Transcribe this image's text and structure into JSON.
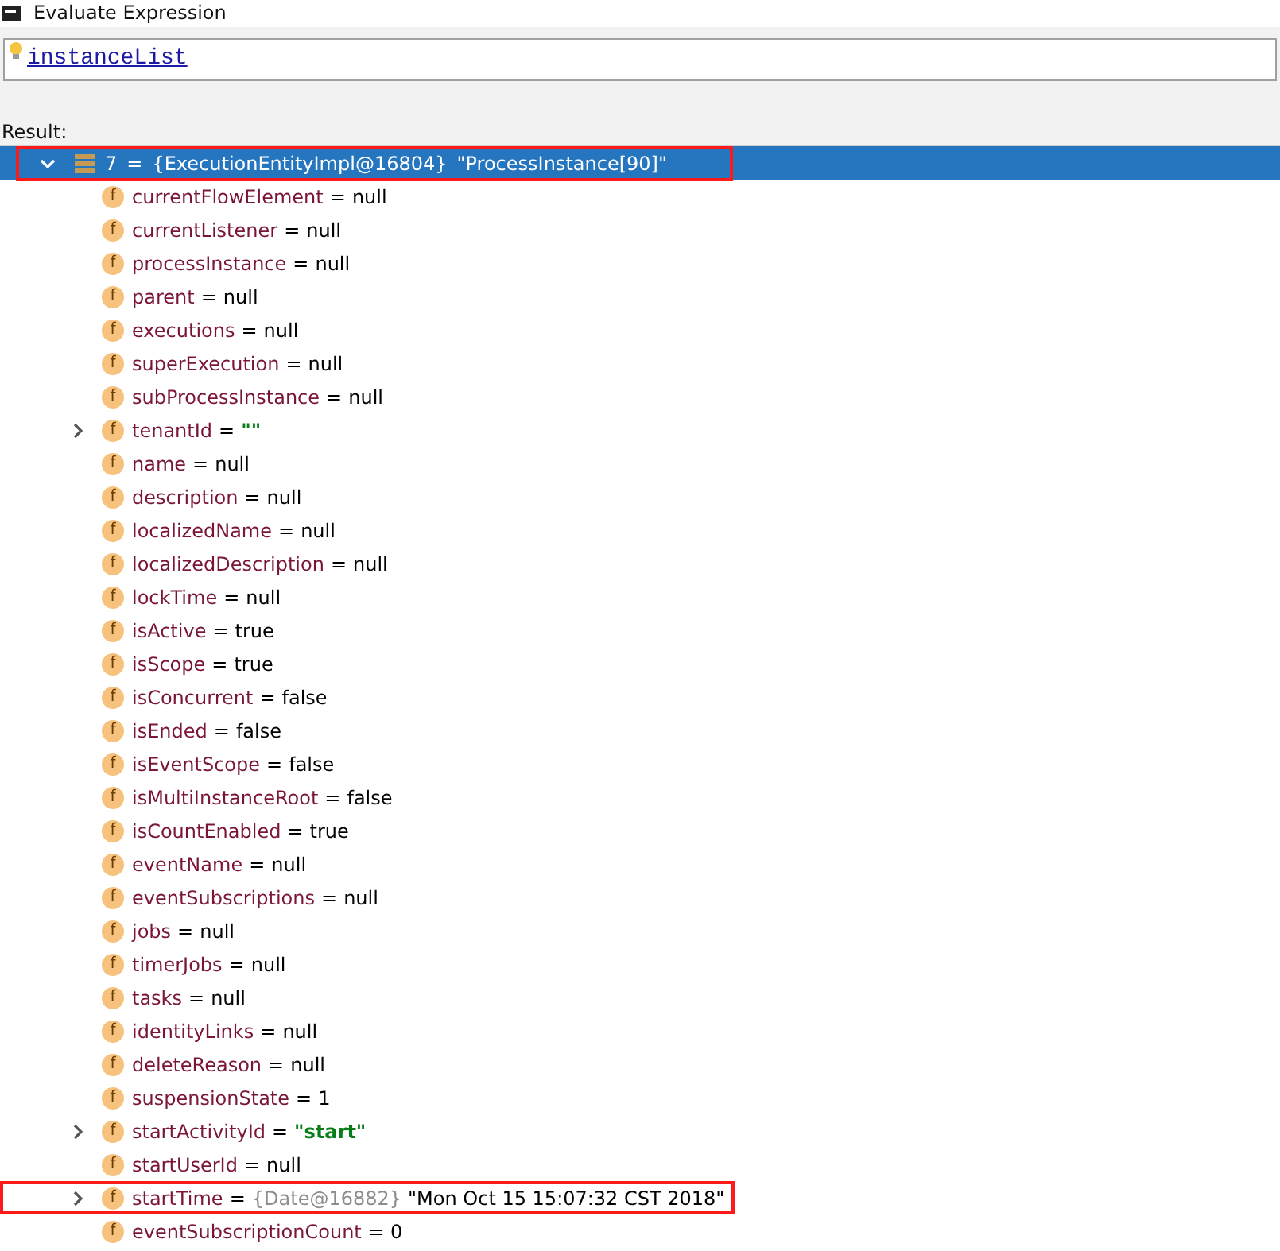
{
  "window": {
    "title": "Evaluate Expression"
  },
  "expression": {
    "value": "instanceList"
  },
  "result_label": "Result:",
  "root": {
    "index": "7",
    "separator": "=",
    "type_label": "{ExecutionEntityImpl@16804}",
    "value": "\"ProcessInstance[90]\"",
    "expanded": true,
    "selected": true,
    "highlighted": true
  },
  "fields": [
    {
      "icon": "f",
      "name": "currentFlowElement",
      "separator": "=",
      "value": "null",
      "kind": "plain",
      "expandable": false,
      "highlighted": false
    },
    {
      "icon": "f",
      "name": "currentListener",
      "separator": "=",
      "value": "null",
      "kind": "plain",
      "expandable": false,
      "highlighted": false
    },
    {
      "icon": "f",
      "name": "processInstance",
      "separator": "=",
      "value": "null",
      "kind": "plain",
      "expandable": false,
      "highlighted": false
    },
    {
      "icon": "f",
      "name": "parent",
      "separator": "=",
      "value": "null",
      "kind": "plain",
      "expandable": false,
      "highlighted": false
    },
    {
      "icon": "f",
      "name": "executions",
      "separator": "=",
      "value": "null",
      "kind": "plain",
      "expandable": false,
      "highlighted": false
    },
    {
      "icon": "f",
      "name": "superExecution",
      "separator": "=",
      "value": "null",
      "kind": "plain",
      "expandable": false,
      "highlighted": false
    },
    {
      "icon": "f",
      "name": "subProcessInstance",
      "separator": "=",
      "value": "null",
      "kind": "plain",
      "expandable": false,
      "highlighted": false
    },
    {
      "icon": "f",
      "name": "tenantId",
      "separator": "=",
      "value": "\"\"",
      "kind": "string",
      "expandable": true,
      "highlighted": false
    },
    {
      "icon": "f",
      "name": "name",
      "separator": "=",
      "value": "null",
      "kind": "plain",
      "expandable": false,
      "highlighted": false
    },
    {
      "icon": "f",
      "name": "description",
      "separator": "=",
      "value": "null",
      "kind": "plain",
      "expandable": false,
      "highlighted": false
    },
    {
      "icon": "f",
      "name": "localizedName",
      "separator": "=",
      "value": "null",
      "kind": "plain",
      "expandable": false,
      "highlighted": false
    },
    {
      "icon": "f",
      "name": "localizedDescription",
      "separator": "=",
      "value": "null",
      "kind": "plain",
      "expandable": false,
      "highlighted": false
    },
    {
      "icon": "f",
      "name": "lockTime",
      "separator": "=",
      "value": "null",
      "kind": "plain",
      "expandable": false,
      "highlighted": false
    },
    {
      "icon": "f",
      "name": "isActive",
      "separator": "=",
      "value": "true",
      "kind": "plain",
      "expandable": false,
      "highlighted": false
    },
    {
      "icon": "f",
      "name": "isScope",
      "separator": "=",
      "value": "true",
      "kind": "plain",
      "expandable": false,
      "highlighted": false
    },
    {
      "icon": "f",
      "name": "isConcurrent",
      "separator": "=",
      "value": "false",
      "kind": "plain",
      "expandable": false,
      "highlighted": false
    },
    {
      "icon": "f",
      "name": "isEnded",
      "separator": "=",
      "value": "false",
      "kind": "plain",
      "expandable": false,
      "highlighted": false
    },
    {
      "icon": "f",
      "name": "isEventScope",
      "separator": "=",
      "value": "false",
      "kind": "plain",
      "expandable": false,
      "highlighted": false
    },
    {
      "icon": "f",
      "name": "isMultiInstanceRoot",
      "separator": "=",
      "value": "false",
      "kind": "plain",
      "expandable": false,
      "highlighted": false
    },
    {
      "icon": "f",
      "name": "isCountEnabled",
      "separator": "=",
      "value": "true",
      "kind": "plain",
      "expandable": false,
      "highlighted": false
    },
    {
      "icon": "f",
      "name": "eventName",
      "separator": "=",
      "value": "null",
      "kind": "plain",
      "expandable": false,
      "highlighted": false
    },
    {
      "icon": "f",
      "name": "eventSubscriptions",
      "separator": "=",
      "value": "null",
      "kind": "plain",
      "expandable": false,
      "highlighted": false
    },
    {
      "icon": "f",
      "name": "jobs",
      "separator": "=",
      "value": "null",
      "kind": "plain",
      "expandable": false,
      "highlighted": false
    },
    {
      "icon": "f",
      "name": "timerJobs",
      "separator": "=",
      "value": "null",
      "kind": "plain",
      "expandable": false,
      "highlighted": false
    },
    {
      "icon": "f",
      "name": "tasks",
      "separator": "=",
      "value": "null",
      "kind": "plain",
      "expandable": false,
      "highlighted": false
    },
    {
      "icon": "f",
      "name": "identityLinks",
      "separator": "=",
      "value": "null",
      "kind": "plain",
      "expandable": false,
      "highlighted": false
    },
    {
      "icon": "f",
      "name": "deleteReason",
      "separator": "=",
      "value": "null",
      "kind": "plain",
      "expandable": false,
      "highlighted": false
    },
    {
      "icon": "f",
      "name": "suspensionState",
      "separator": "=",
      "value": "1",
      "kind": "plain",
      "expandable": false,
      "highlighted": false
    },
    {
      "icon": "f",
      "name": "startActivityId",
      "separator": "=",
      "value": "\"start\"",
      "kind": "string",
      "expandable": true,
      "highlighted": false
    },
    {
      "icon": "f",
      "name": "startUserId",
      "separator": "=",
      "value": "null",
      "kind": "plain",
      "expandable": false,
      "highlighted": false
    },
    {
      "icon": "f",
      "name": "startTime",
      "separator": "=",
      "type_label": "{Date@16882}",
      "value": "\"Mon Oct 15 15:07:32 CST 2018\"",
      "kind": "plain",
      "expandable": true,
      "highlighted": true
    },
    {
      "icon": "f",
      "name": "eventSubscriptionCount",
      "separator": "=",
      "value": "0",
      "kind": "plain",
      "expandable": false,
      "highlighted": false
    }
  ]
}
